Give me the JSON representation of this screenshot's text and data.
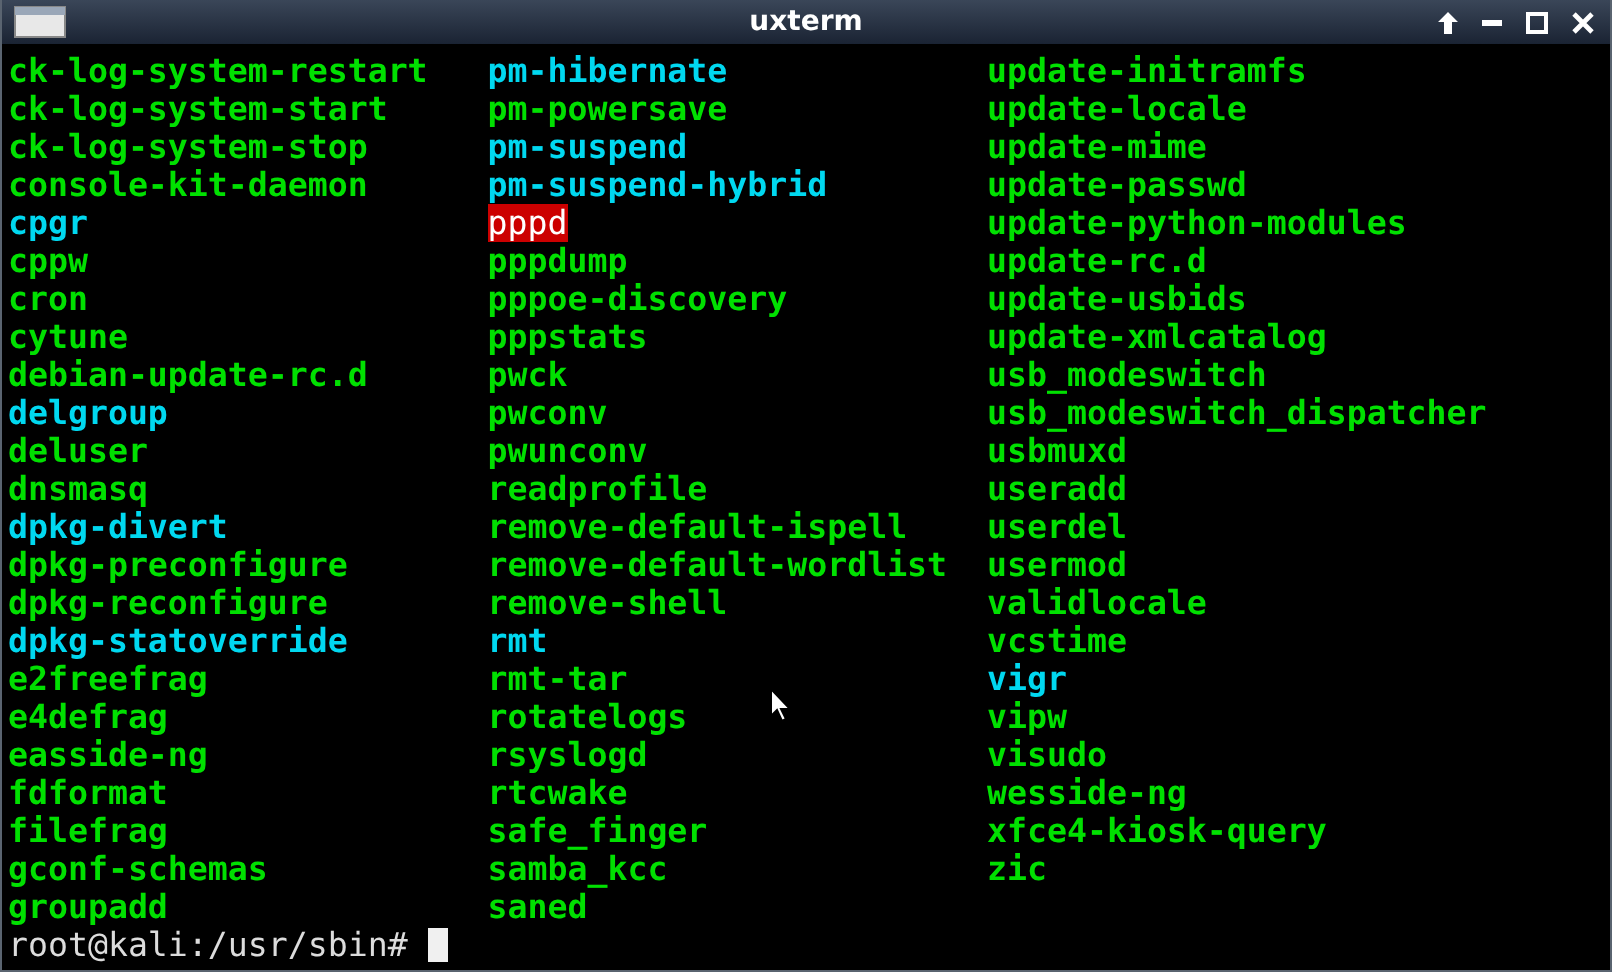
{
  "window": {
    "title": "uxterm"
  },
  "listing": [
    [
      {
        "name": "ck-log-system-restart",
        "kind": "file"
      },
      {
        "name": "ck-log-system-start",
        "kind": "file"
      },
      {
        "name": "ck-log-system-stop",
        "kind": "file"
      },
      {
        "name": "console-kit-daemon",
        "kind": "file"
      },
      {
        "name": "cpgr",
        "kind": "link"
      },
      {
        "name": "cppw",
        "kind": "file"
      },
      {
        "name": "cron",
        "kind": "file"
      },
      {
        "name": "cytune",
        "kind": "file"
      },
      {
        "name": "debian-update-rc.d",
        "kind": "file"
      },
      {
        "name": "delgroup",
        "kind": "link"
      },
      {
        "name": "deluser",
        "kind": "file"
      },
      {
        "name": "dnsmasq",
        "kind": "file"
      },
      {
        "name": "dpkg-divert",
        "kind": "link"
      },
      {
        "name": "dpkg-preconfigure",
        "kind": "file"
      },
      {
        "name": "dpkg-reconfigure",
        "kind": "file"
      },
      {
        "name": "dpkg-statoverride",
        "kind": "link"
      },
      {
        "name": "e2freefrag",
        "kind": "file"
      },
      {
        "name": "e4defrag",
        "kind": "file"
      },
      {
        "name": "easside-ng",
        "kind": "file"
      },
      {
        "name": "fdformat",
        "kind": "file"
      },
      {
        "name": "filefrag",
        "kind": "file"
      },
      {
        "name": "gconf-schemas",
        "kind": "file"
      },
      {
        "name": "groupadd",
        "kind": "file"
      }
    ],
    [
      {
        "name": "pm-hibernate",
        "kind": "link"
      },
      {
        "name": "pm-powersave",
        "kind": "file"
      },
      {
        "name": "pm-suspend",
        "kind": "link"
      },
      {
        "name": "pm-suspend-hybrid",
        "kind": "link"
      },
      {
        "name": "pppd",
        "kind": "setuid"
      },
      {
        "name": "pppdump",
        "kind": "file"
      },
      {
        "name": "pppoe-discovery",
        "kind": "file"
      },
      {
        "name": "pppstats",
        "kind": "file"
      },
      {
        "name": "pwck",
        "kind": "file"
      },
      {
        "name": "pwconv",
        "kind": "file"
      },
      {
        "name": "pwunconv",
        "kind": "file"
      },
      {
        "name": "readprofile",
        "kind": "file"
      },
      {
        "name": "remove-default-ispell",
        "kind": "file"
      },
      {
        "name": "remove-default-wordlist",
        "kind": "file"
      },
      {
        "name": "remove-shell",
        "kind": "file"
      },
      {
        "name": "rmt",
        "kind": "link"
      },
      {
        "name": "rmt-tar",
        "kind": "file"
      },
      {
        "name": "rotatelogs",
        "kind": "file"
      },
      {
        "name": "rsyslogd",
        "kind": "file"
      },
      {
        "name": "rtcwake",
        "kind": "file"
      },
      {
        "name": "safe_finger",
        "kind": "file"
      },
      {
        "name": "samba_kcc",
        "kind": "file"
      },
      {
        "name": "saned",
        "kind": "file"
      }
    ],
    [
      {
        "name": "update-initramfs",
        "kind": "file"
      },
      {
        "name": "update-locale",
        "kind": "file"
      },
      {
        "name": "update-mime",
        "kind": "file"
      },
      {
        "name": "update-passwd",
        "kind": "file"
      },
      {
        "name": "update-python-modules",
        "kind": "file"
      },
      {
        "name": "update-rc.d",
        "kind": "file"
      },
      {
        "name": "update-usbids",
        "kind": "file"
      },
      {
        "name": "update-xmlcatalog",
        "kind": "file"
      },
      {
        "name": "usb_modeswitch",
        "kind": "file"
      },
      {
        "name": "usb_modeswitch_dispatcher",
        "kind": "file"
      },
      {
        "name": "usbmuxd",
        "kind": "file"
      },
      {
        "name": "useradd",
        "kind": "file"
      },
      {
        "name": "userdel",
        "kind": "file"
      },
      {
        "name": "usermod",
        "kind": "file"
      },
      {
        "name": "validlocale",
        "kind": "file"
      },
      {
        "name": "vcstime",
        "kind": "file"
      },
      {
        "name": "vigr",
        "kind": "link"
      },
      {
        "name": "vipw",
        "kind": "file"
      },
      {
        "name": "visudo",
        "kind": "file"
      },
      {
        "name": "wesside-ng",
        "kind": "file"
      },
      {
        "name": "xfce4-kiosk-query",
        "kind": "file"
      },
      {
        "name": "zic",
        "kind": "file"
      }
    ]
  ],
  "prompt": "root@kali:/usr/sbin#"
}
